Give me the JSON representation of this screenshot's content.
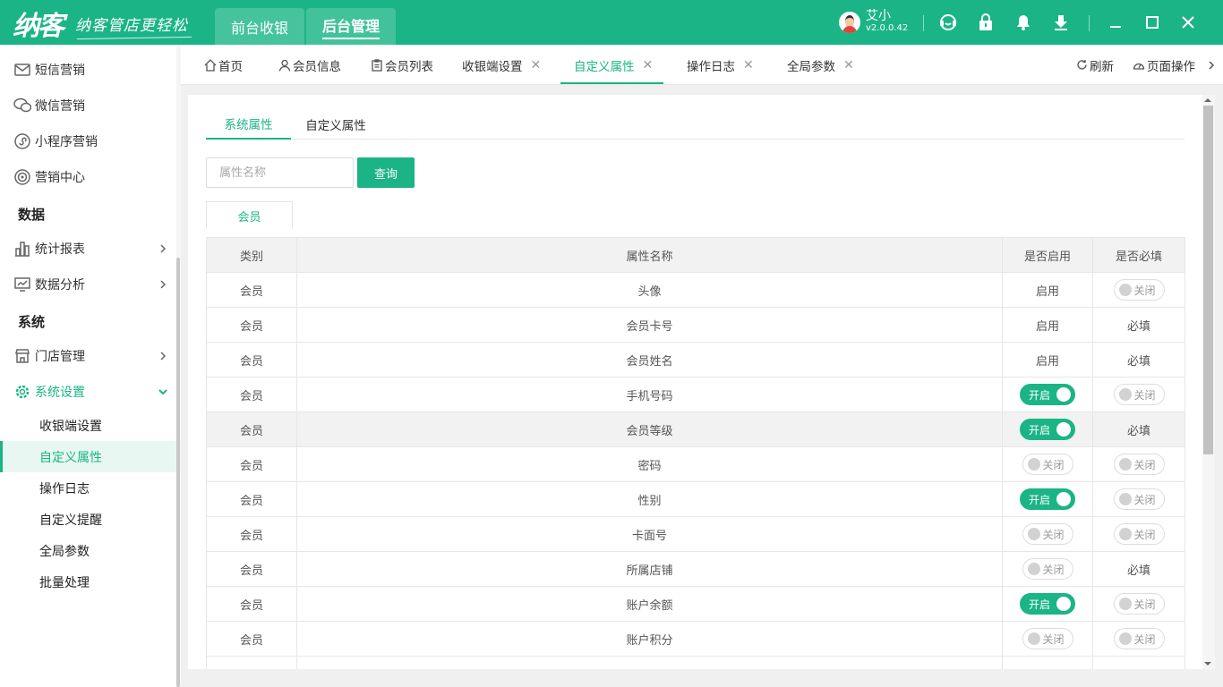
{
  "topbar": {
    "logo": "纳客",
    "slogan": "纳客管店更轻松",
    "tabs": [
      {
        "label": "前台收银"
      },
      {
        "label": "后台管理"
      }
    ],
    "user": {
      "name": "艾小",
      "version": "v2.0.0.42"
    }
  },
  "sidebar": {
    "items": [
      {
        "label": "短信营销"
      },
      {
        "label": "微信营销"
      },
      {
        "label": "小程序营销"
      },
      {
        "label": "营销中心"
      },
      {
        "label": "统计报表"
      },
      {
        "label": "数据分析"
      },
      {
        "label": "门店管理"
      },
      {
        "label": "系统设置"
      }
    ],
    "groups": [
      {
        "label": "数据"
      },
      {
        "label": "系统"
      }
    ],
    "sub": [
      {
        "label": "收银端设置"
      },
      {
        "label": "自定义属性"
      },
      {
        "label": "操作日志"
      },
      {
        "label": "自定义提醒"
      },
      {
        "label": "全局参数"
      },
      {
        "label": "批量处理"
      }
    ]
  },
  "pagetabs": {
    "tabs": [
      {
        "label": "首页"
      },
      {
        "label": "会员信息"
      },
      {
        "label": "会员列表"
      },
      {
        "label": "收银端设置"
      },
      {
        "label": "自定义属性"
      },
      {
        "label": "操作日志"
      },
      {
        "label": "全局参数"
      }
    ],
    "refresh": "刷新",
    "page_ops": "页面操作"
  },
  "main": {
    "subtabs": [
      {
        "label": "系统属性"
      },
      {
        "label": "自定义属性"
      }
    ],
    "search": {
      "placeholder": "属性名称",
      "button": "查询"
    },
    "category_tab": "会员",
    "table": {
      "headers": [
        "类别",
        "属性名称",
        "是否启用",
        "是否必填"
      ],
      "rows": [
        {
          "category": "会员",
          "name": "头像",
          "enabled": "启用",
          "required": "关闭"
        },
        {
          "category": "会员",
          "name": "会员卡号",
          "enabled": "启用",
          "required": "必填"
        },
        {
          "category": "会员",
          "name": "会员姓名",
          "enabled": "启用",
          "required": "必填"
        },
        {
          "category": "会员",
          "name": "手机号码",
          "enabled": "开启",
          "required": "关闭"
        },
        {
          "category": "会员",
          "name": "会员等级",
          "enabled": "开启",
          "required": "必填"
        },
        {
          "category": "会员",
          "name": "密码",
          "enabled": "关闭",
          "required": "关闭"
        },
        {
          "category": "会员",
          "name": "性别",
          "enabled": "开启",
          "required": "关闭"
        },
        {
          "category": "会员",
          "name": "卡面号",
          "enabled": "关闭",
          "required": "关闭"
        },
        {
          "category": "会员",
          "name": "所属店铺",
          "enabled": "关闭",
          "required": "必填"
        },
        {
          "category": "会员",
          "name": "账户余额",
          "enabled": "开启",
          "required": "关闭"
        },
        {
          "category": "会员",
          "name": "账户积分",
          "enabled": "关闭",
          "required": "关闭"
        }
      ]
    }
  },
  "colors": {
    "brand": "#1bb486",
    "highlight_row": "#f2f2f2"
  }
}
